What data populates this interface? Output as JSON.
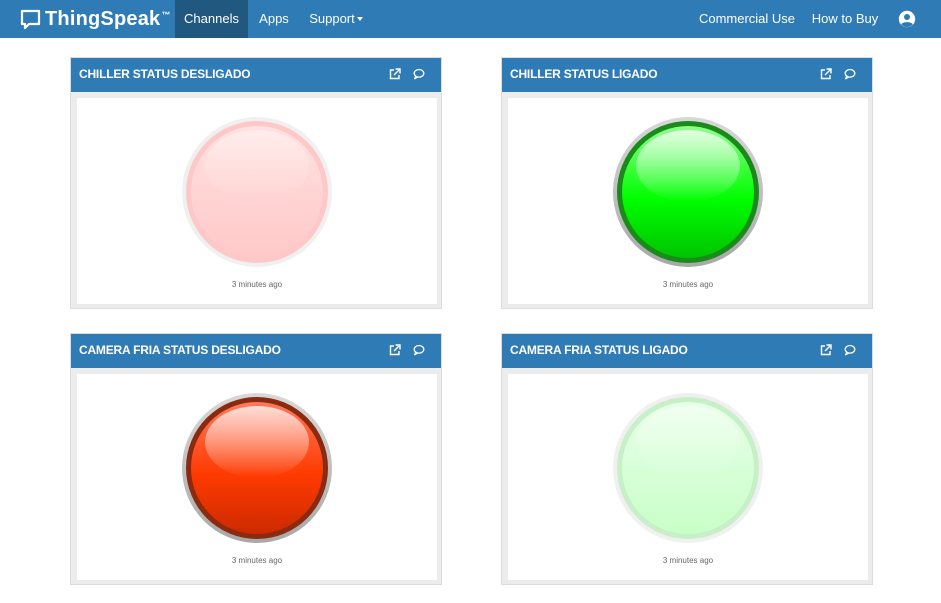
{
  "navbar": {
    "brand": "ThingSpeak",
    "brand_tm": "™",
    "items": {
      "channels": "Channels",
      "apps": "Apps",
      "support": "Support",
      "commercial": "Commercial Use",
      "howtobuy": "How to Buy"
    }
  },
  "widgets": [
    {
      "title": "CHILLER STATUS DESLIGADO",
      "timestamp": "3 minutes ago",
      "lamp_color": "red",
      "lamp_state": "off"
    },
    {
      "title": "CHILLER STATUS LIGADO",
      "timestamp": "3 minutes ago",
      "lamp_color": "green",
      "lamp_state": "on"
    },
    {
      "title": "CAMERA FRIA STATUS DESLIGADO",
      "timestamp": "3 minutes ago",
      "lamp_color": "red",
      "lamp_state": "on"
    },
    {
      "title": "CAMERA FRIA STATUS LIGADO",
      "timestamp": "3 minutes ago",
      "lamp_color": "green",
      "lamp_state": "off"
    }
  ],
  "colors": {
    "primary": "#2f7bb5",
    "active_nav": "#21587f",
    "lamp_red_on": "#ff3300",
    "lamp_red_off": "#ffd0d0",
    "lamp_green_on": "#00ee00",
    "lamp_green_off": "#ccffcc"
  },
  "icons": {
    "brand": "chat-bubble-icon",
    "user": "user-avatar-icon",
    "external": "external-link-icon",
    "comment": "comment-icon"
  }
}
